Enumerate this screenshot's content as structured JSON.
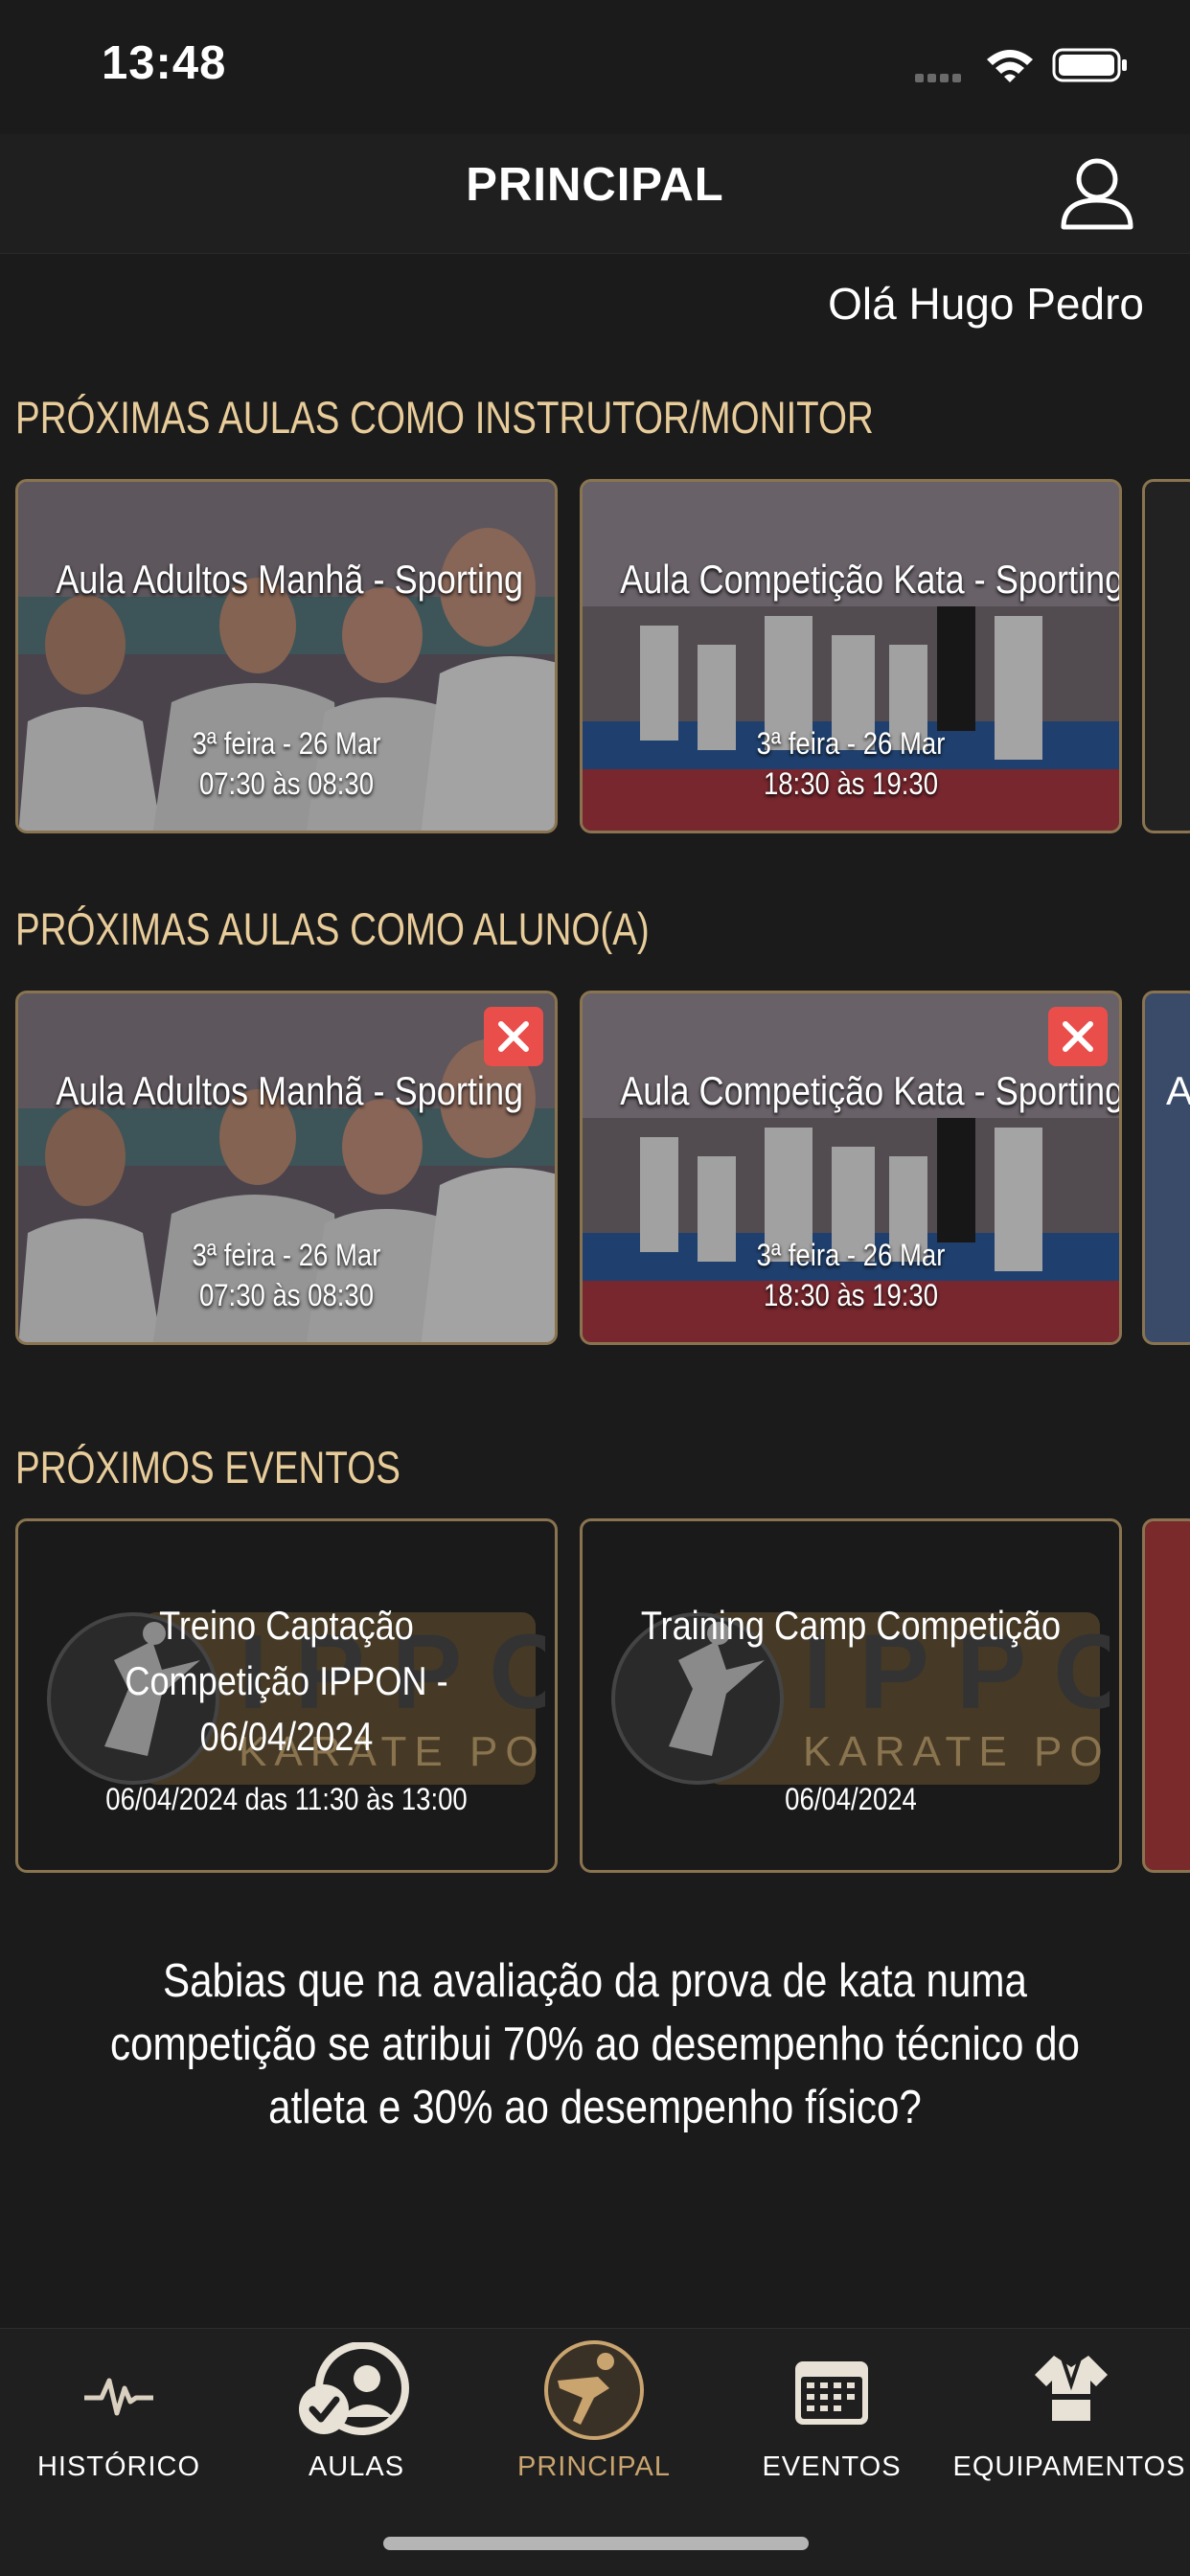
{
  "status_bar": {
    "time": "13:48"
  },
  "header": {
    "title": "PRINCIPAL"
  },
  "greeting": "Olá Hugo Pedro",
  "instructor_section": {
    "title": "PRÓXIMAS AULAS COMO INSTRUTOR/MONITOR",
    "cards": [
      {
        "title": "Aula Adultos Manhã - Sporting",
        "date": "3ª feira - 26 Mar",
        "time": "07:30 às 08:30"
      },
      {
        "title": "Aula Competição Kata - Sporting",
        "date": "3ª feira - 26 Mar",
        "time": "18:30 às 19:30"
      }
    ]
  },
  "student_section": {
    "title": "PRÓXIMAS AULAS COMO ALUNO(A)",
    "cards": [
      {
        "title": "Aula Adultos Manhã - Sporting",
        "date": "3ª feira - 26 Mar",
        "time": "07:30 às 08:30"
      },
      {
        "title": "Aula Competição Kata - Sporting",
        "date": "3ª feira - 26 Mar",
        "time": "18:30 às 19:30"
      }
    ],
    "partial_card_letter": "A"
  },
  "events_section": {
    "title": "PRÓXIMOS EVENTOS",
    "cards": [
      {
        "title": "Treino Captação Competição IPPON - 06/04/2024",
        "date": "06/04/2024 das 11:30 às 13:00",
        "logo_text": "IPPON",
        "logo_subtext": "KARATE PORTUGAL"
      },
      {
        "title": "Training Camp Competição",
        "date": "06/04/2024",
        "logo_text": "IPPON",
        "logo_subtext": "KARATE PORTUGAL"
      }
    ]
  },
  "fact": "Sabias que na avaliação da prova de kata numa competição se atribui 70% ao desempenho técnico do atleta e 30% ao desempenho físico?",
  "tabs": [
    {
      "label": "HISTÓRICO",
      "icon": "pulse-icon",
      "active": false
    },
    {
      "label": "AULAS",
      "icon": "user-check-icon",
      "active": false
    },
    {
      "label": "PRINCIPAL",
      "icon": "karate-kick-icon",
      "active": true
    },
    {
      "label": "EVENTOS",
      "icon": "calendar-icon",
      "active": false
    },
    {
      "label": "EQUIPAMENTOS",
      "icon": "gi-icon",
      "active": false
    }
  ],
  "colors": {
    "accent": "#e8cc9a",
    "active_tab": "#c9a46e",
    "card_border": "#8a7450",
    "remove": "#e94e4b",
    "background": "#1b1b1b"
  }
}
